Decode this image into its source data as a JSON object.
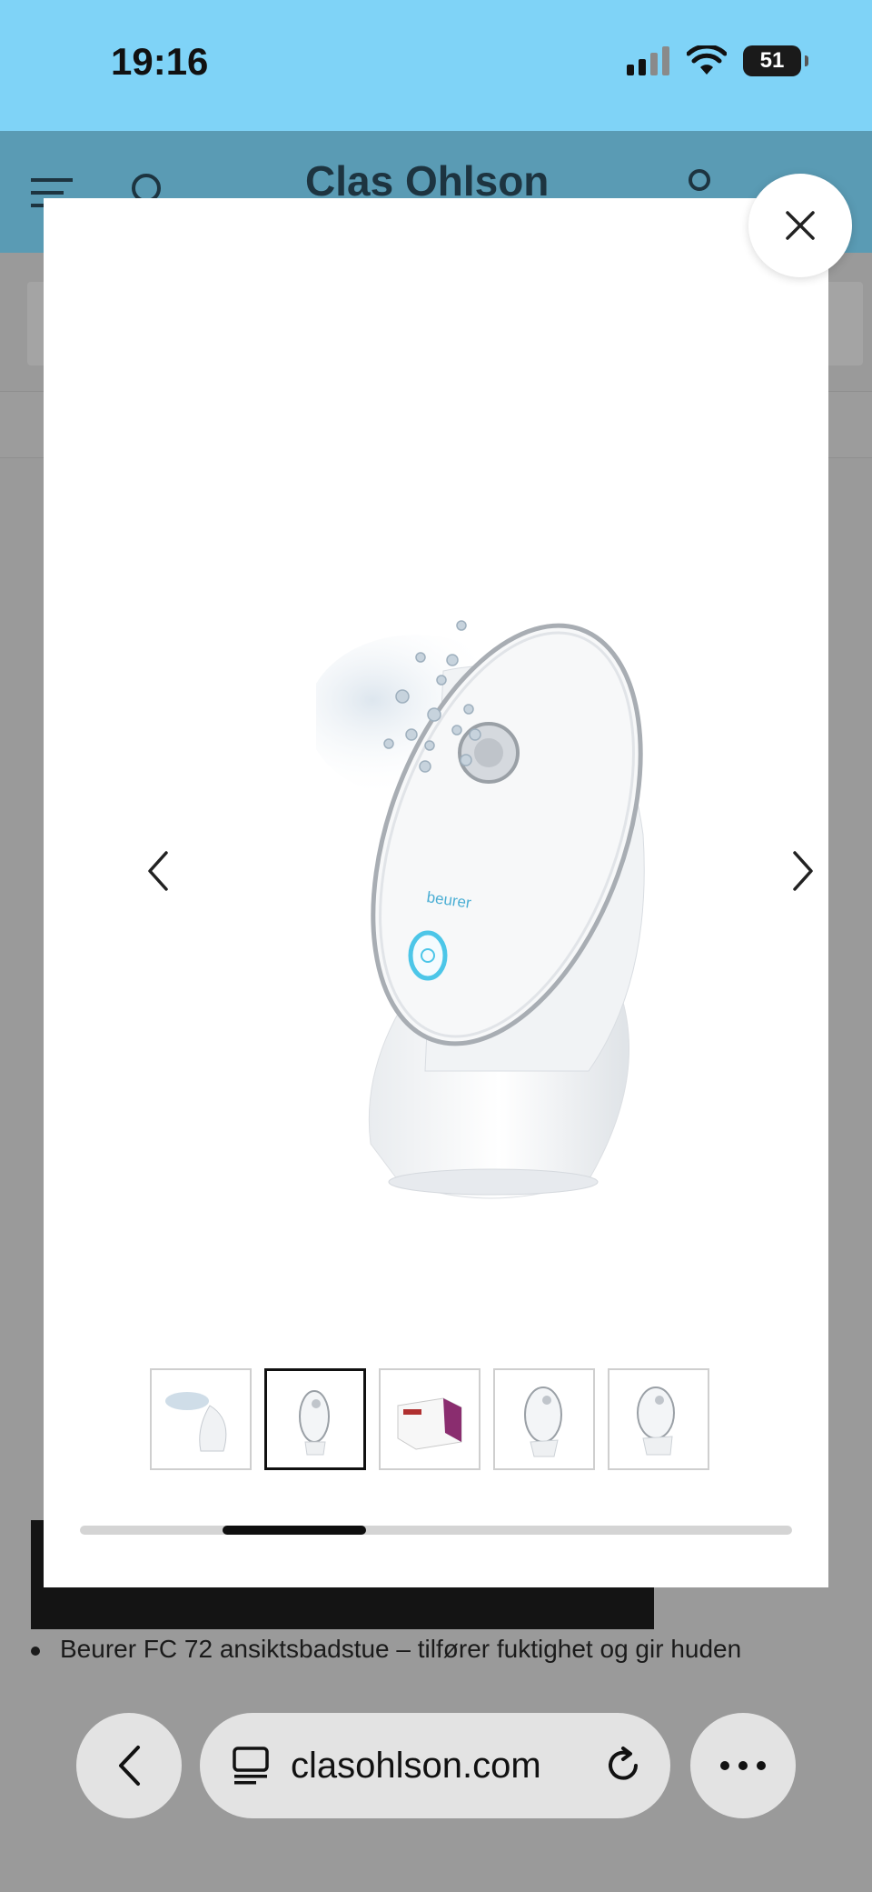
{
  "status_bar": {
    "time": "19:16",
    "battery": "51"
  },
  "site": {
    "logo": "Clas Ohlson",
    "bullet": "Beurer FC 72 ansiktsbadstue – tilfører fuktighet og gir huden"
  },
  "modal": {
    "product_brand_mark": "beurer",
    "thumbnails_count": 5,
    "active_thumbnail_index": 1,
    "scroll_position": 0.2
  },
  "browser": {
    "url": "clasohlson.com"
  },
  "colors": {
    "status_bar_bg": "#7fd3f7",
    "header_bg": "#5a9bb4",
    "accent_ring": "#4cc6e8"
  }
}
